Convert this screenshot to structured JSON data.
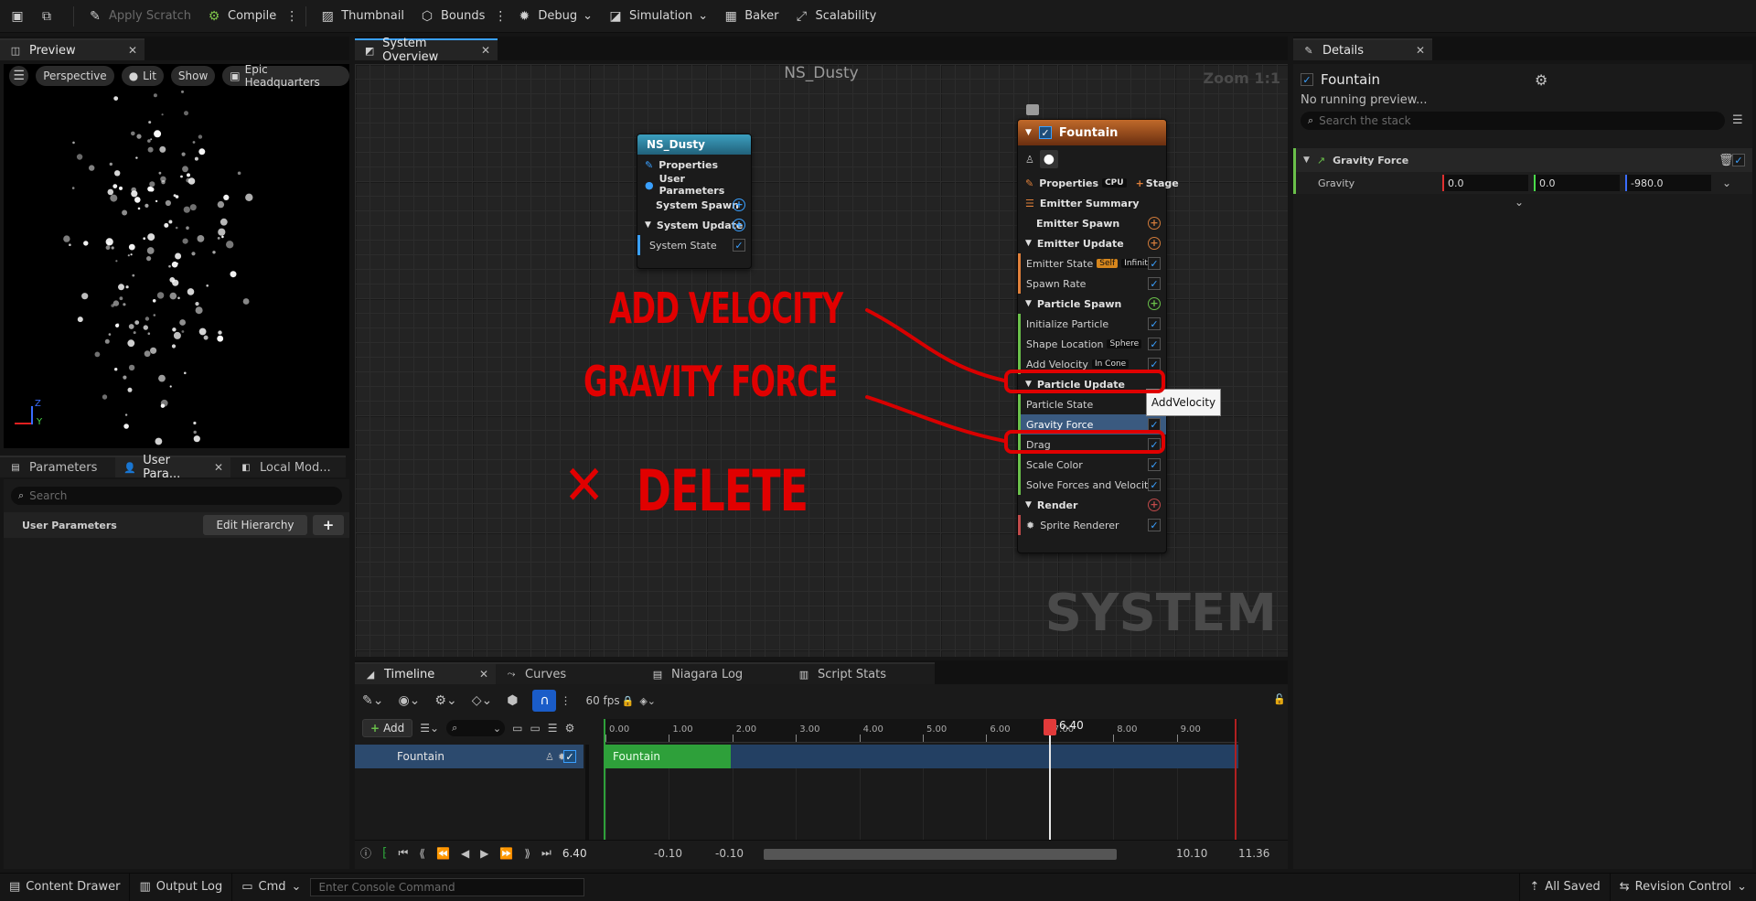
{
  "toolbar": {
    "apply_scratch": "Apply Scratch",
    "compile": "Compile",
    "thumbnail": "Thumbnail",
    "bounds": "Bounds",
    "debug": "Debug",
    "simulation": "Simulation",
    "baker": "Baker",
    "scalability": "Scalability"
  },
  "preview_panel": {
    "tab": "Preview",
    "perspective": "Perspective",
    "lit": "Lit",
    "show": "Show",
    "level": "Epic Headquarters"
  },
  "params_panel": {
    "tabs": [
      "Parameters",
      "User Para...",
      "Local Mod..."
    ],
    "search_placeholder": "Search",
    "section": "User Parameters",
    "edit_hierarchy": "Edit Hierarchy",
    "add": "+"
  },
  "graph": {
    "tab": "System Overview",
    "system_name": "NS_Dusty",
    "zoom": "Zoom 1:1",
    "watermark": "SYSTEM",
    "system_node": {
      "title": "NS_Dusty",
      "properties": "Properties",
      "user_parameters": "User Parameters",
      "system_spawn": "System Spawn",
      "system_update": "System Update",
      "system_state": "System State"
    },
    "emitter_node": {
      "title": "Fountain",
      "properties": "Properties",
      "cpu": "CPU",
      "stage": "Stage",
      "emitter_summary": "Emitter Summary",
      "emitter_spawn": "Emitter Spawn",
      "emitter_update": "Emitter Update",
      "emitter_state": "Emitter State",
      "emitter_state_tag1": "Self",
      "emitter_state_tag2": "Infinite",
      "spawn_rate": "Spawn Rate",
      "particle_spawn": "Particle Spawn",
      "initialize_particle": "Initialize Particle",
      "shape_location": "Shape Location",
      "shape_tag": "Sphere",
      "add_velocity": "Add Velocity",
      "add_velocity_tag": "In Cone",
      "particle_update": "Particle Update",
      "particle_state": "Particle State",
      "gravity_force": "Gravity Force",
      "drag": "Drag",
      "scale_color": "Scale Color",
      "solve_forces": "Solve Forces and Velocity",
      "render": "Render",
      "sprite_renderer": "Sprite Renderer"
    },
    "tooltip": "AddVelocity",
    "annotations": {
      "add_velocity": "ADD VELOCITY",
      "gravity_force": "GRAVITY FORCE",
      "delete_mark": "✕",
      "delete": "DELETE"
    }
  },
  "details": {
    "tab": "Details",
    "title": "Fountain",
    "status": "No running preview...",
    "search_placeholder": "Search the stack",
    "module": "Gravity Force",
    "param_label": "Gravity",
    "x": "0.0",
    "y": "0.0",
    "z": "-980.0"
  },
  "timeline": {
    "tabs": [
      "Timeline",
      "Curves",
      "Niagara Log",
      "Script Stats"
    ],
    "fps": "60 fps",
    "add": "Add",
    "track": "Fountain",
    "clip": "Fountain",
    "ruler": [
      "0.00",
      "1.00",
      "2.00",
      "3.00",
      "4.00",
      "5.00",
      "6.00",
      "7.00",
      "8.00",
      "9.00"
    ],
    "playhead": "6.40",
    "current_time": "6.40",
    "range_start": "-0.10",
    "range_start2": "-0.10",
    "range_end": "10.10",
    "range_end2": "11.36"
  },
  "statusbar": {
    "content_drawer": "Content Drawer",
    "output_log": "Output Log",
    "cmd": "Cmd",
    "console_placeholder": "Enter Console Command",
    "all_saved": "All Saved",
    "revision_control": "Revision Control"
  },
  "colors": {
    "accent_blue": "#3aa0ff",
    "emitter_header": "#a0521e",
    "system_header": "#2a7a96",
    "clip_green": "#2ea03a",
    "annotation_red": "#e10000"
  }
}
